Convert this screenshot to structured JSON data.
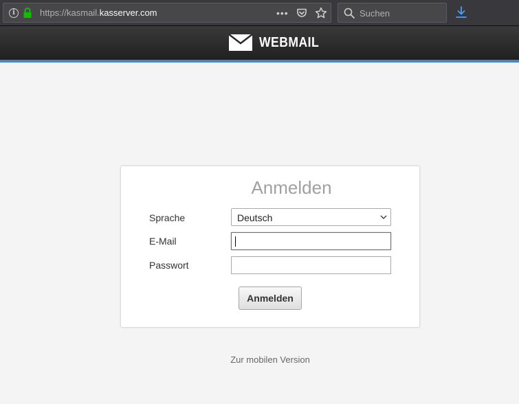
{
  "browser": {
    "url_prefix": "https://kasmail.",
    "url_domain": "kasserver.com",
    "more_label": "•••",
    "search_placeholder": "Suchen"
  },
  "header": {
    "logo_text": "WEBMAIL",
    "stripe_color": "#4a85c4"
  },
  "login": {
    "title": "Anmelden",
    "language_label": "Sprache",
    "language_value": "Deutsch",
    "email_label": "E-Mail",
    "email_value": "",
    "password_label": "Passwort",
    "password_value": "",
    "submit_label": "Anmelden"
  },
  "footer": {
    "mobile_link": "Zur mobilen Version"
  },
  "icons": [
    "info-icon",
    "lock-icon",
    "more-icon",
    "pocket-icon",
    "star-icon",
    "search-icon",
    "download-icon",
    "envelope-icon",
    "chevron-down-icon"
  ]
}
